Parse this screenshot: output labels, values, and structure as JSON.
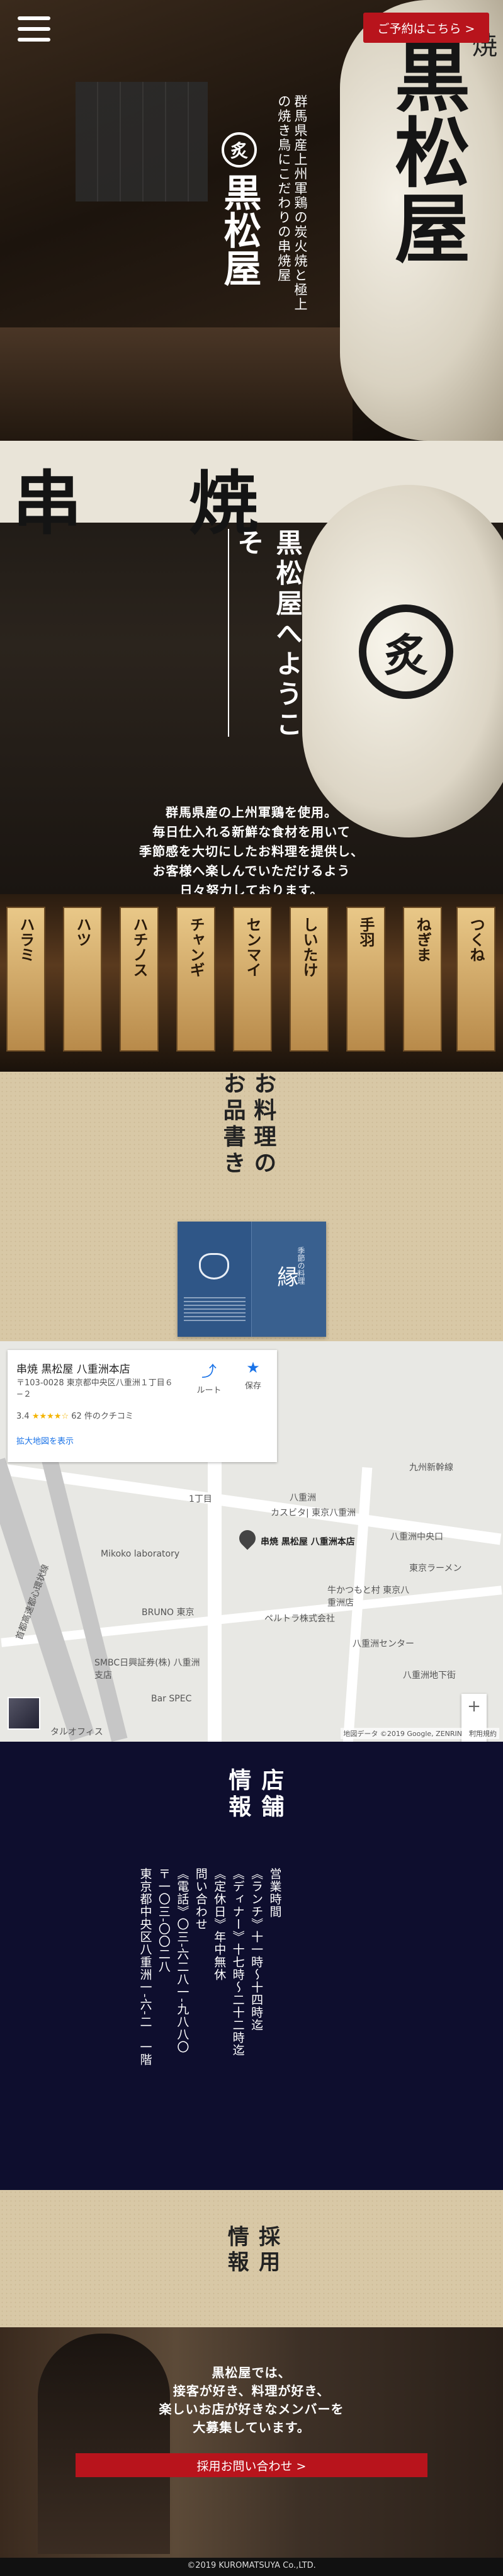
{
  "header": {
    "reserve_label": "ご予約はこちら >"
  },
  "hero": {
    "tagline": "群馬県産上州軍鶏の炭火焼と極上の焼き鳥にこだわりの串焼屋",
    "logo_mark": "炙",
    "logo_name": "黒松屋",
    "lantern_text": "黒松屋",
    "lantern_small": "焼"
  },
  "welcome": {
    "title": "黒松屋へようこそ",
    "banner_chars": [
      "串",
      "焼"
    ],
    "lantern_crest": "炙",
    "lines": [
      "群馬県産の上州軍鶏を使用。",
      "毎日仕入れる新鮮な食材を用いて",
      "季節感を大切にしたお料理を提供し、",
      "お客様へ楽しんでいただけるよう",
      "日々努力しております。"
    ]
  },
  "grill": {
    "planks": [
      "ハラミ",
      "ハツ",
      "ハチノス",
      "チャンギ",
      "センマイ",
      "しいたけ",
      "手羽",
      "ねぎま",
      "つくね"
    ]
  },
  "menu": {
    "title": "お料理のお品書き",
    "card_label": "縁",
    "card_small": "季節の料理"
  },
  "map": {
    "place_name": "串焼 黒松屋 八重洲本店",
    "address": "〒103-0028 東京都中央区八重洲１丁目６−２",
    "rating": "3.4",
    "stars": "★★★★☆",
    "reviews": "62 件のクチコミ",
    "enlarge": "拡大地図を表示",
    "route_label": "ルート",
    "save_label": "保存",
    "pin_label": "串焼 黒松屋 八重洲本店",
    "zoom_in": "+",
    "zoom_out": "−",
    "attribution": "地図データ ©2019 Google, ZENRIN　利用規約",
    "labels": [
      "九州新幹線",
      "1丁目",
      "八重洲中央口",
      "カスビタ| 東京八重洲",
      "八重洲",
      "首都高速都心環状線",
      "SMBC日興証券(株) 八重洲支店",
      "BRUNO 東京",
      "ペルトラ株式会社",
      "牛かつもと村 東京八重洲店",
      "Bar SPEC",
      "八重洲地下街",
      "タルオフィス",
      "八重洲センター",
      "Mikoko laboratory",
      "東京ラーメン"
    ]
  },
  "info": {
    "title": "店舗情報",
    "columns": [
      "営業時間",
      "《ランチ》十一時〜十四時迄",
      "《ディナー》十七時〜二十二時迄",
      "《定休日》年中無休",
      "問い合わせ",
      "《電話》〇三‐六二八一‐九八八〇",
      "〒一〇三‐〇〇二八",
      "東京都中央区八重洲一‐六‐二　一階"
    ]
  },
  "recruit": {
    "title": "採用情報",
    "lines": [
      "黒松屋では、",
      "接客が好き、料理が好き、",
      "楽しいお店が好きなメンバーを",
      "大募集しています。"
    ],
    "button_label": "採用お問い合わせ >"
  },
  "footer": {
    "copyright": "©2019 KUROMATSUYA Co.,LTD."
  }
}
